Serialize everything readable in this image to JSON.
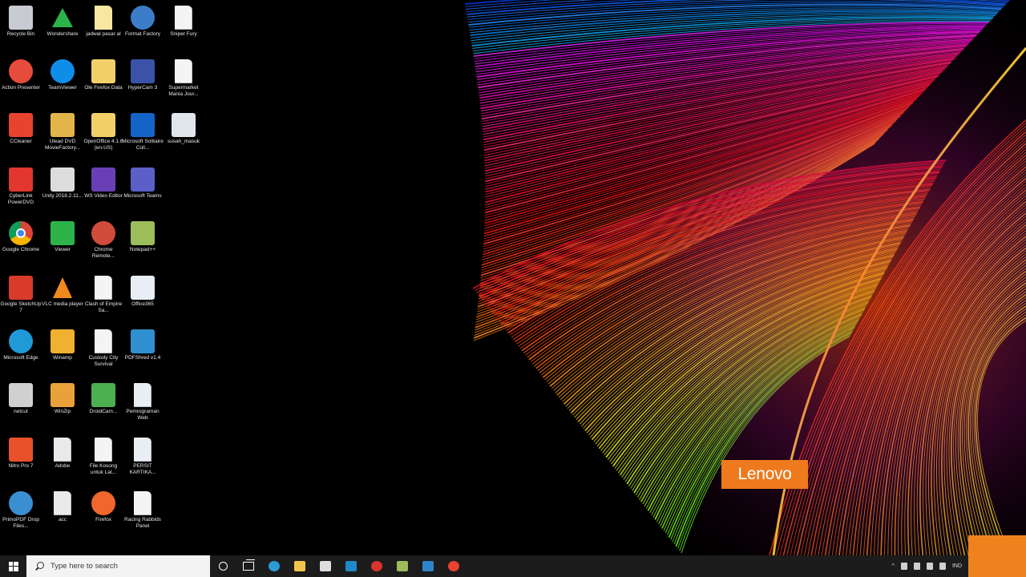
{
  "desktop": {
    "icons": [
      {
        "label": "Recycle Bin",
        "icon": "recycle-bin-icon",
        "color": "#c8ccd2"
      },
      {
        "label": "Action Presenter",
        "icon": "action-presenter-icon",
        "color": "#e64b3b"
      },
      {
        "label": "CCleaner",
        "icon": "ccleaner-icon",
        "color": "#e8432d"
      },
      {
        "label": "CyberLink PowerDVD",
        "icon": "powerdvd-icon",
        "color": "#e2372e"
      },
      {
        "label": "Google Chrome",
        "icon": "chrome-icon",
        "color": "#4285f4"
      },
      {
        "label": "Google SketchUp 7",
        "icon": "sketchup-icon",
        "color": "#d93b2b"
      },
      {
        "label": "Microsoft Edge",
        "icon": "edge-icon",
        "color": "#1f9ad6"
      },
      {
        "label": "netcut",
        "icon": "netcut-icon",
        "color": "#d0d0d0"
      },
      {
        "label": "Nitro Pro 7",
        "icon": "nitro-icon",
        "color": "#e8512a"
      },
      {
        "label": "PrimoPDF Drop Files...",
        "icon": "primopdf-icon",
        "color": "#3a8fd0"
      },
      {
        "label": "Wondershare",
        "icon": "wondershare-icon",
        "color": "#2bb34a"
      },
      {
        "label": "TeamViewer",
        "icon": "teamviewer-icon",
        "color": "#0e8ee9"
      },
      {
        "label": "Ulead DVD MovieFactory...",
        "icon": "ulead-icon",
        "color": "#e3b44a"
      },
      {
        "label": "Unity 2018.2.11...",
        "icon": "unity-icon",
        "color": "#dcdcdc"
      },
      {
        "label": "Viewer",
        "icon": "viewer-icon",
        "color": "#2db34a"
      },
      {
        "label": "VLC media player",
        "icon": "vlc-icon",
        "color": "#f18a1c"
      },
      {
        "label": "Winamp",
        "icon": "winamp-icon",
        "color": "#f0b030"
      },
      {
        "label": "WinZip",
        "icon": "winzip-icon",
        "color": "#e9a23b"
      },
      {
        "label": "Adobe",
        "icon": "adobe-icon",
        "color": "#e9e9e9"
      },
      {
        "label": "acc",
        "icon": "acc-icon",
        "color": "#e9e9e9"
      },
      {
        "label": "jadwal pasar al",
        "icon": "file-icon",
        "color": "#f7e7a0"
      },
      {
        "label": "Ole Firefox Data",
        "icon": "folder-icon",
        "color": "#f3cf6a"
      },
      {
        "label": "OpenOffice 4.1.6 (en-US)",
        "icon": "openoffice-icon",
        "color": "#f3cf6a"
      },
      {
        "label": "WS Video Editor",
        "icon": "video-editor-icon",
        "color": "#6a3fb5"
      },
      {
        "label": "Chrome Remote...",
        "icon": "chrome-remote-icon",
        "color": "#d24b3b"
      },
      {
        "label": "Clash of Empire Sa...",
        "icon": "file-icon",
        "color": "#f4f4f4"
      },
      {
        "label": "Custody City Survival",
        "icon": "file-icon",
        "color": "#f4f4f4"
      },
      {
        "label": "DroidCam...",
        "icon": "droidcam-icon",
        "color": "#4caf50"
      },
      {
        "label": "File Kosong untuk Lat...",
        "icon": "file-icon",
        "color": "#f4f4f4"
      },
      {
        "label": "Firefox",
        "icon": "firefox-icon",
        "color": "#f0672b"
      },
      {
        "label": "Format Factory",
        "icon": "format-factory-icon",
        "color": "#3b7dc9"
      },
      {
        "label": "HyperCam 3",
        "icon": "hypercam-icon",
        "color": "#3a53a8"
      },
      {
        "label": "Microsoft Solitaire Coll...",
        "icon": "solitaire-icon",
        "color": "#1464c8"
      },
      {
        "label": "Microsoft Teams",
        "icon": "teams-icon",
        "color": "#5b5fc7"
      },
      {
        "label": "Notepad++",
        "icon": "notepad-icon",
        "color": "#9bbd5a"
      },
      {
        "label": "Office365",
        "icon": "office-icon",
        "color": "#e8eef4"
      },
      {
        "label": "PDFShred v1.4",
        "icon": "pdfshred-icon",
        "color": "#2f8fd0"
      },
      {
        "label": "Pemrograman Web",
        "icon": "file-icon",
        "color": "#e8eef4"
      },
      {
        "label": "PERSIT KARTIKA...",
        "icon": "file-icon",
        "color": "#e8eef4"
      },
      {
        "label": "Racing Rabbids Panel",
        "icon": "file-icon",
        "color": "#f4f4f4"
      },
      {
        "label": "Sniper Fury",
        "icon": "file-icon",
        "color": "#f4f4f4"
      },
      {
        "label": "Supermarket Mania Jour...",
        "icon": "file-icon",
        "color": "#f4f4f4"
      },
      {
        "label": "susah_masuk",
        "icon": "shortcut-icon",
        "color": "#dfe5ea"
      }
    ]
  },
  "wallpaper": {
    "brand_badge": "Lenovo",
    "badge_color": "#ee7a1d"
  },
  "taskbar": {
    "search_placeholder": "Type here to search",
    "pinned": [
      {
        "name": "edge-pinned-icon",
        "color": "#2d9ad8"
      },
      {
        "name": "file-explorer-icon",
        "color": "#f3c44d"
      },
      {
        "name": "store-icon",
        "color": "#dedede"
      },
      {
        "name": "lenovo-vantage-icon",
        "color": "#1e88c8"
      },
      {
        "name": "mcafee-icon",
        "color": "#d8342b"
      },
      {
        "name": "notepad-pinned-icon",
        "color": "#9bbd5a"
      },
      {
        "name": "mail-icon",
        "color": "#2d84c9"
      },
      {
        "name": "nitro-pinned-icon",
        "color": "#e8432d"
      }
    ],
    "tray": {
      "language": "IND"
    }
  }
}
